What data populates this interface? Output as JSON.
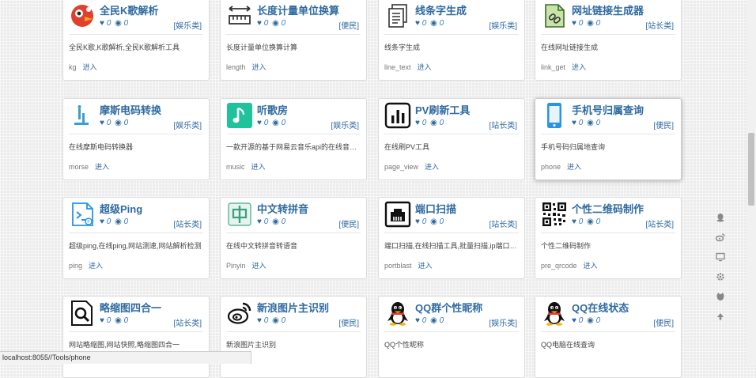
{
  "status_bar": {
    "url": "localhost:8055//Tools/phone"
  },
  "tools": [
    {
      "title": "全民K歌解析",
      "likes": "0",
      "views": "0",
      "category": "[娱乐类]",
      "desc": "全民K歌,K歌解析,全民K歌解析工具",
      "code": "kg",
      "enter": "进入",
      "icon": "kg-bird-icon"
    },
    {
      "title": "长度计量单位换算",
      "likes": "0",
      "views": "0",
      "category": "[便民]",
      "desc": "长度计量单位换算计算",
      "code": "length",
      "enter": "进入",
      "icon": "ruler-icon"
    },
    {
      "title": "线条字生成",
      "likes": "0",
      "views": "0",
      "category": "[娱乐类]",
      "desc": "线条字生成",
      "code": "line_text",
      "enter": "进入",
      "icon": "documents-icon"
    },
    {
      "title": "网址链接生成器",
      "likes": "0",
      "views": "0",
      "category": "[站长类]",
      "desc": "在线网址链接生成",
      "code": "link_get",
      "enter": "进入",
      "icon": "link-doc-icon"
    },
    {
      "title": "摩斯电码转换",
      "likes": "0",
      "views": "0",
      "category": "[娱乐类]",
      "desc": "在线摩斯电码转换器",
      "code": "morse",
      "enter": "进入",
      "icon": "morse-icon"
    },
    {
      "title": "听歌房",
      "likes": "0",
      "views": "0",
      "category": "[娱乐类]",
      "desc": "一款开源的基于网易云音乐api的在线音乐播放器",
      "code": "music",
      "enter": "进入",
      "icon": "music-note-icon"
    },
    {
      "title": "PV刷新工具",
      "likes": "0",
      "views": "0",
      "category": "[站长类]",
      "desc": "在线刷PV工具",
      "code": "page_view",
      "enter": "进入",
      "icon": "bar-chart-icon"
    },
    {
      "title": "手机号归属查询",
      "likes": "0",
      "views": "0",
      "category": "[便民]",
      "desc": "手机号码归属地查询",
      "code": "phone",
      "enter": "进入",
      "icon": "phone-icon"
    },
    {
      "title": "超级Ping",
      "likes": "0",
      "views": "0",
      "category": "[站长类]",
      "desc": "超级ping,在线ping,网站测速,网站解析检测",
      "code": "ping",
      "enter": "进入",
      "icon": "terminal-icon"
    },
    {
      "title": "中文转拼音",
      "likes": "0",
      "views": "0",
      "category": "[便民]",
      "desc": "在线中文转拼音转语音",
      "code": "Pinyin",
      "enter": "进入",
      "icon": "chinese-char-icon"
    },
    {
      "title": "端口扫描",
      "likes": "0",
      "views": "0",
      "category": "[站长类]",
      "desc": "端口扫描,在线扫描工具,批量扫描,ip端口扫描",
      "code": "portblast",
      "enter": "进入",
      "icon": "port-scan-icon"
    },
    {
      "title": "个性二维码制作",
      "likes": "0",
      "views": "0",
      "category": "[站长类]",
      "desc": "个性二维码制作",
      "code": "pre_qrcode",
      "enter": "进入",
      "icon": "qrcode-icon"
    },
    {
      "title": "略缩图四合一",
      "likes": "0",
      "views": "0",
      "category": "[站长类]",
      "desc": "网站略缩图,网站快照,略缩图四合一",
      "code": "",
      "enter": "",
      "icon": "magnifier-doc-icon"
    },
    {
      "title": "新浪图片主识别",
      "likes": "0",
      "views": "0",
      "category": "[便民]",
      "desc": "新浪图片主识别",
      "code": "",
      "enter": "",
      "icon": "weibo-icon"
    },
    {
      "title": "QQ群个性昵称",
      "likes": "0",
      "views": "0",
      "category": "[娱乐类]",
      "desc": "QQ个性昵称",
      "code": "",
      "enter": "",
      "icon": "qq-penguin-icon"
    },
    {
      "title": "QQ在线状态",
      "likes": "0",
      "views": "0",
      "category": "[便民]",
      "desc": "QQ电脑在线查询",
      "code": "",
      "enter": "",
      "icon": "qq-penguin-icon"
    }
  ],
  "float_buttons": [
    "qq-icon",
    "weibo-icon",
    "monitor-icon",
    "gear-icon",
    "github-icon",
    "arrow-up-icon"
  ]
}
